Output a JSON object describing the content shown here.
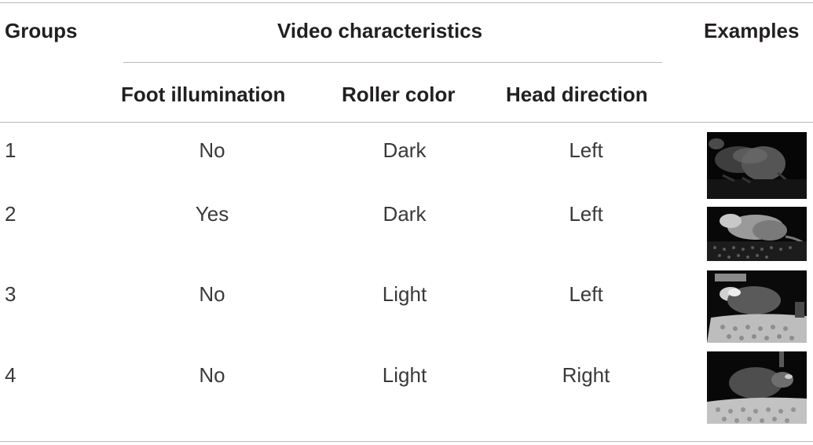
{
  "headers": {
    "groups": "Groups",
    "video_characteristics": "Video characteristics",
    "examples": "Examples",
    "foot_illumination": "Foot illumination",
    "roller_color": "Roller color",
    "head_direction": "Head direction"
  },
  "rows": [
    {
      "group": "1",
      "foot": "No",
      "roller": "Dark",
      "head": "Left"
    },
    {
      "group": "2",
      "foot": "Yes",
      "roller": "Dark",
      "head": "Left"
    },
    {
      "group": "3",
      "foot": "No",
      "roller": "Light",
      "head": "Left"
    },
    {
      "group": "4",
      "foot": "No",
      "roller": "Light",
      "head": "Right"
    }
  ],
  "example_images": [
    "mouse-video-frame-dark-roller-left",
    "mouse-video-frame-illuminated-foot-left",
    "mouse-video-frame-light-roller-left",
    "mouse-video-frame-light-roller-right"
  ]
}
